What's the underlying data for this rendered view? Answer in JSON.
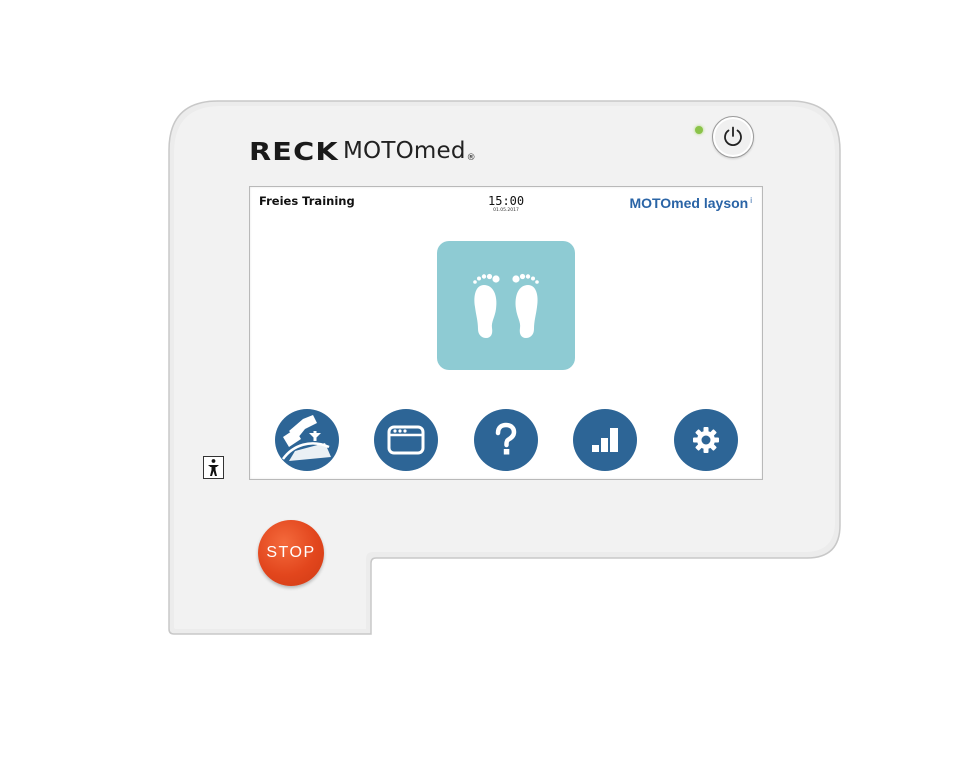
{
  "device": {
    "brand": "RECK",
    "product": "MOTOmed",
    "product_mark": "®",
    "stop_label": "STOP"
  },
  "screen": {
    "title": "Freies Training",
    "time": "15:00",
    "date": "01.05.2017",
    "model": "MOTOmed layson",
    "model_superscript": "i"
  },
  "icons": {
    "mode_tile": "feet-icon",
    "nav": [
      "pedal-walker-icon",
      "window-icon",
      "help-icon",
      "bar-chart-icon",
      "gear-icon"
    ]
  },
  "colors": {
    "accent_blue": "#2d6596",
    "tile_teal": "#8ecbd3",
    "stop_red": "#e2461d",
    "led_green": "#8bc34a",
    "model_text": "#2a64a6"
  }
}
